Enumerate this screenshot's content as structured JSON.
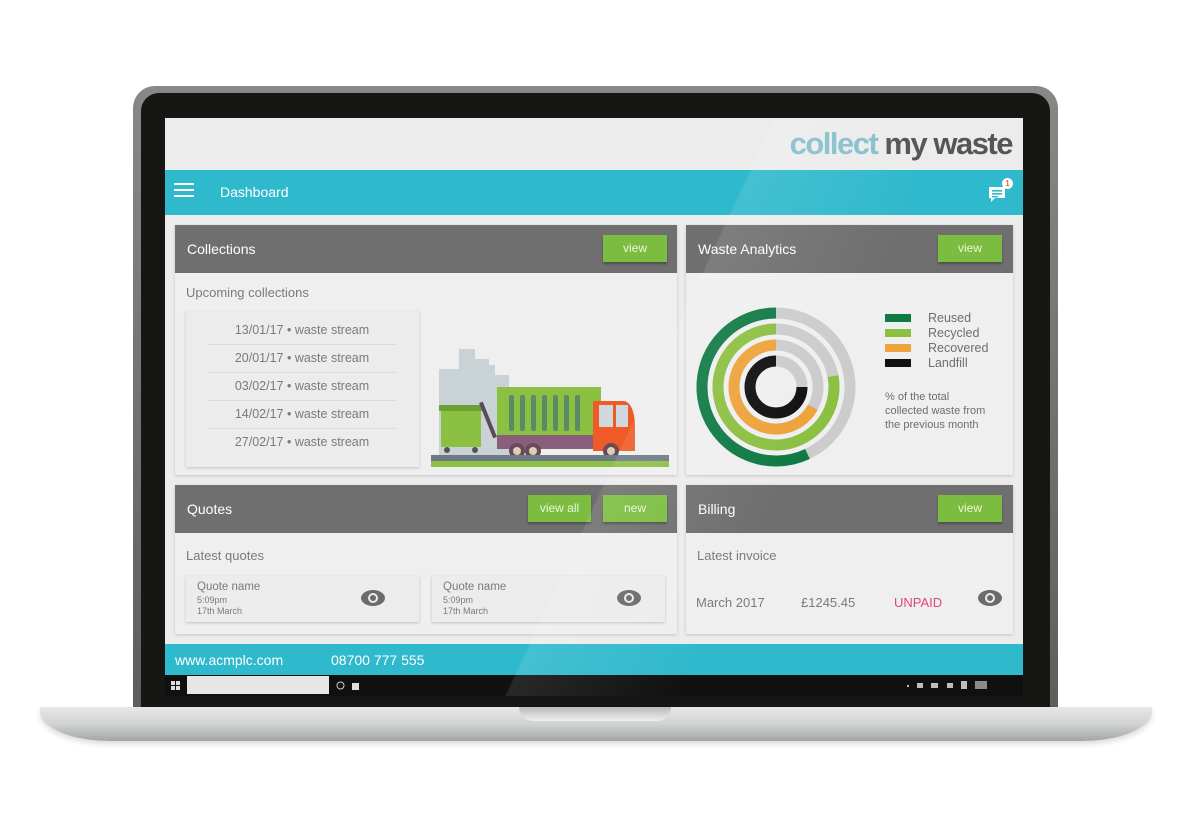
{
  "brand": {
    "part1": "collect",
    "part2": "my waste"
  },
  "appbar": {
    "title": "Dashboard",
    "notification_count": "1"
  },
  "colors": {
    "primary": "#2fb9cc",
    "accent_green": "#7cbd41",
    "card_header": "#6f6f6f",
    "unpaid": "#e0457b"
  },
  "collections": {
    "title": "Collections",
    "view_label": "view",
    "subtitle": "Upcoming collections",
    "items": [
      "13/01/17 • waste stream",
      "20/01/17 • waste stream",
      "03/02/17 • waste stream",
      "14/02/17 • waste stream",
      "27/02/17 • waste stream"
    ]
  },
  "analytics": {
    "title": "Waste Analytics",
    "view_label": "view",
    "note": "% of the total collected waste from the previous month"
  },
  "chart_data": {
    "type": "pie",
    "subtype": "radial-ring",
    "title": "",
    "description": "% of the total collected waste from the previous month",
    "legend_position": "right",
    "series": [
      {
        "name": "Reused",
        "value": 57,
        "color": "#0f7a44"
      },
      {
        "name": "Recycled",
        "value": 78,
        "color": "#8cc043"
      },
      {
        "name": "Recovered",
        "value": 67,
        "color": "#eea33c"
      },
      {
        "name": "Landfill",
        "value": 75,
        "color": "#111111"
      }
    ],
    "track_color": "#cccccc",
    "range": [
      0,
      100
    ]
  },
  "quotes": {
    "title": "Quotes",
    "view_all_label": "view all",
    "new_label": "new",
    "subtitle": "Latest quotes",
    "items": [
      {
        "name": "Quote name",
        "time": "5:09pm",
        "date": "17th March"
      },
      {
        "name": "Quote name",
        "time": "5:09pm",
        "date": "17th March"
      }
    ]
  },
  "billing": {
    "title": "Billing",
    "view_label": "view",
    "subtitle": "Latest invoice",
    "month": "March 2017",
    "amount": "£1245.45",
    "status": "UNPAID"
  },
  "footer": {
    "website": "www.acmplc.com",
    "phone": "08700 777 555"
  }
}
